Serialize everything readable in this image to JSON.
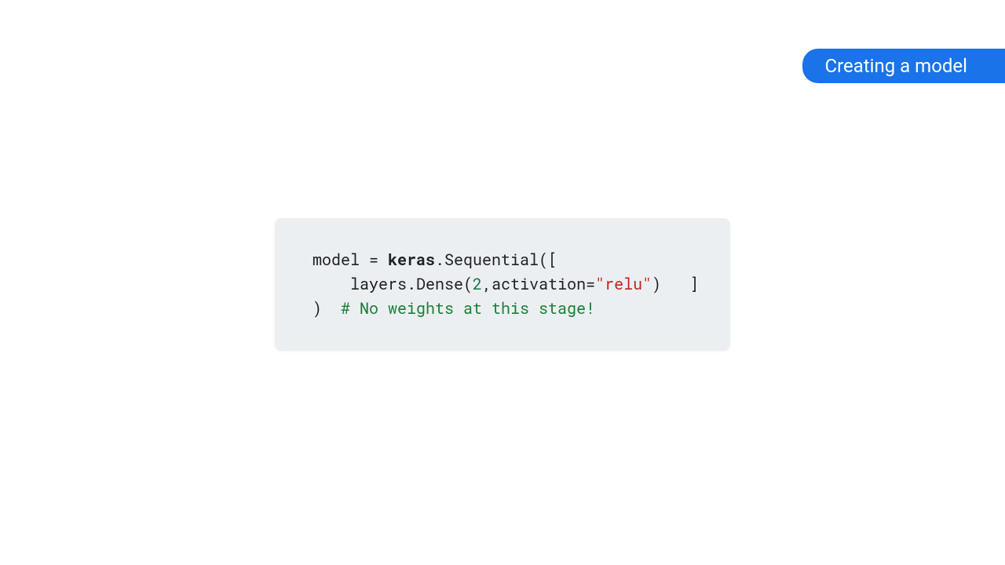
{
  "title": "Creating a model",
  "code": {
    "l1_a": "model = ",
    "l1_b": "keras",
    "l1_c": ".Sequential([",
    "l2_a": "    layers.Dense(",
    "l2_num": "2",
    "l2_b": ",activation=",
    "l2_str": "\"relu\"",
    "l2_c": ")   ]",
    "l3_a": ")  ",
    "l3_comment": "# No weights at this stage!"
  }
}
